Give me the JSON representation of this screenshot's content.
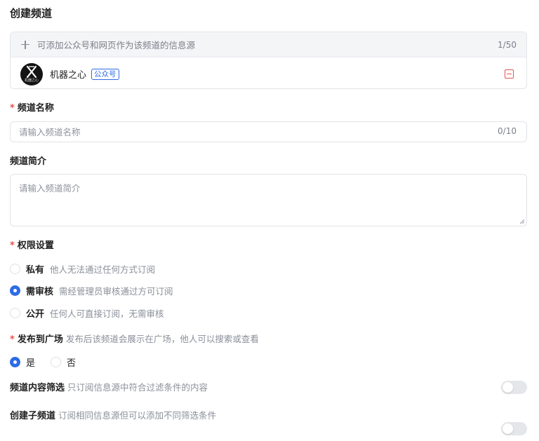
{
  "page": {
    "title": "创建频道"
  },
  "sources": {
    "add_label": "可添加公众号和网页作为该频道的信息源",
    "count": "1/50",
    "items": [
      {
        "name": "机器之心",
        "badge": "公众号",
        "avatar_text": "机器之心"
      }
    ]
  },
  "channel_name": {
    "label": "频道名称",
    "required_mark": "*",
    "placeholder": "请输入频道名称",
    "value": "",
    "counter": "0/10"
  },
  "channel_desc": {
    "label": "频道简介",
    "placeholder": "请输入频道简介",
    "value": ""
  },
  "permission": {
    "label": "权限设置",
    "required_mark": "*",
    "selected": "需审核",
    "options": [
      {
        "label": "私有",
        "desc": "他人无法通过任何方式订阅",
        "checked": false
      },
      {
        "label": "需审核",
        "desc": "需经管理员审核通过方可订阅",
        "checked": true
      },
      {
        "label": "公开",
        "desc": "任何人可直接订阅，无需审核",
        "checked": false
      }
    ]
  },
  "publish": {
    "label": "发布到广场",
    "required_mark": "*",
    "hint": "发布后该频道会展示在广场，他人可以搜索或查看",
    "selected": "是",
    "options": [
      {
        "label": "是",
        "checked": true
      },
      {
        "label": "否",
        "checked": false
      }
    ]
  },
  "filter": {
    "label": "频道内容筛选",
    "hint": "只订阅信息源中符合过滤条件的内容",
    "enabled": false
  },
  "sub_channel": {
    "label": "创建子频道",
    "hint": "订阅相同信息源但可以添加不同筛选条件",
    "enabled": false
  },
  "colors": {
    "primary": "#2e6be6",
    "required": "#e5534b",
    "border": "#e1e3e7",
    "muted": "#8a8f99"
  }
}
